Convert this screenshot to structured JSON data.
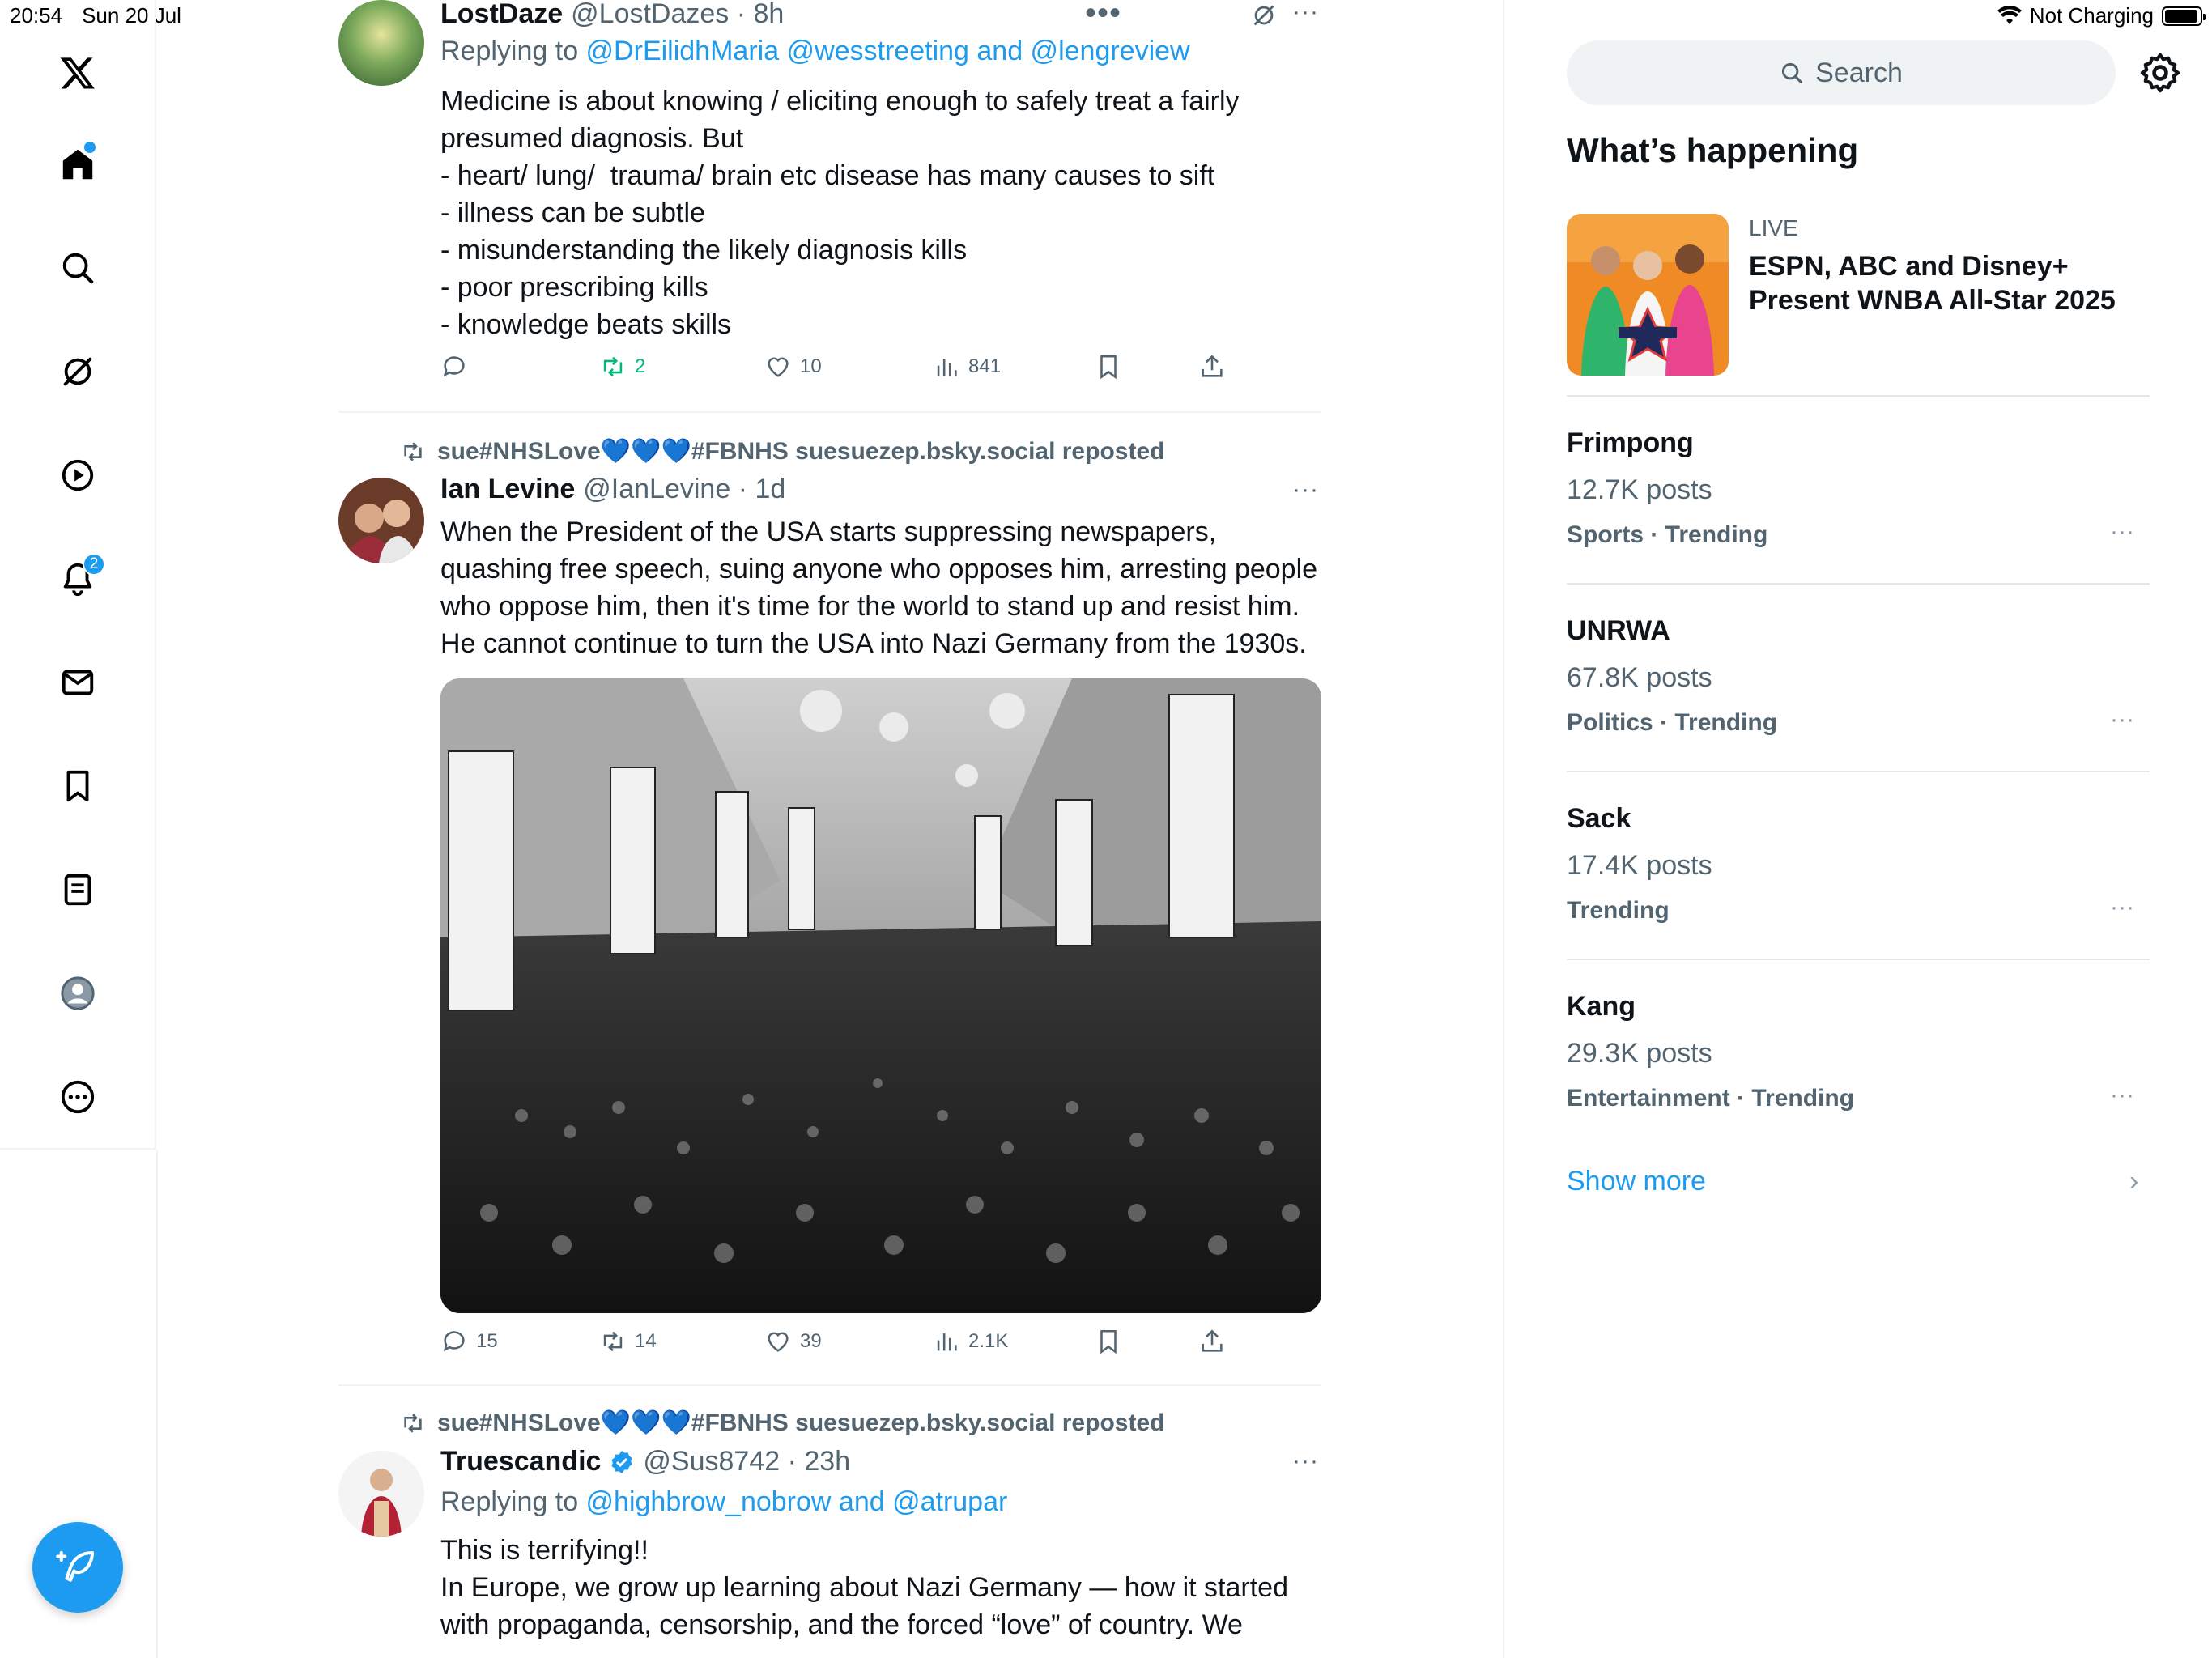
{
  "status_bar": {
    "time": "20:54",
    "date": "Sun 20 Jul",
    "charging": "Not Charging",
    "battery_level": 0.95
  },
  "nav": {
    "notifications_count": "2"
  },
  "feed": {
    "tweet1": {
      "name": "LostDaze",
      "handle": "@LostDazes · 8h",
      "replying_prefix": "Replying to ",
      "replying_to": "@DrEilidhMaria @wesstreeting and @lengreview",
      "text": "Medicine is about knowing / eliciting enough to safely treat a fairly\npresumed diagnosis. But\n- heart/ lung/  trauma/ brain etc disease has many causes to sift\n- illness can be subtle\n- misunderstanding the likely diagnosis kills\n- poor prescribing kills\n- knowledge beats skills",
      "retweets": "2",
      "likes": "10",
      "views": "841"
    },
    "tweet2": {
      "reposted_by": "sue#NHSLove💙💙💙#FBNHS suesuezep.bsky.social reposted",
      "name": "Ian Levine",
      "handle": "@IanLevine · 1d",
      "text": "When the President of the USA starts suppressing newspapers,\nquashing free speech, suing anyone who opposes him, arresting people\nwho oppose him, then it's time for the world to stand up and resist him.\nHe cannot continue to turn the USA into Nazi Germany from the 1930s.",
      "replies": "15",
      "retweets": "14",
      "likes": "39",
      "views": "2.1K"
    },
    "tweet3": {
      "reposted_by": "sue#NHSLove💙💙💙#FBNHS suesuezep.bsky.social reposted",
      "name": "Truescandic",
      "handle": "@Sus8742 · 23h",
      "replying_prefix": "Replying to ",
      "replying_to": "@highbrow_nobrow and @atrupar",
      "text": "This is terrifying!!\nIn Europe, we grow up learning about Nazi Germany — how it started\nwith propaganda, censorship, and the forced “love” of country. We"
    }
  },
  "sidebar": {
    "search_placeholder": "Search",
    "title": "What’s happening",
    "live": {
      "label": "LIVE",
      "title": "ESPN, ABC and Disney+ Present WNBA All-Star 2025"
    },
    "trends": [
      {
        "name": "Frimpong",
        "posts": "12.7K posts",
        "meta": "Sports · Trending"
      },
      {
        "name": "UNRWA",
        "posts": "67.8K posts",
        "meta": "Politics · Trending"
      },
      {
        "name": "Sack",
        "posts": "17.4K posts",
        "meta": "Trending"
      },
      {
        "name": "Kang",
        "posts": "29.3K posts",
        "meta": "Entertainment · Trending"
      }
    ],
    "show_more": "Show more"
  }
}
